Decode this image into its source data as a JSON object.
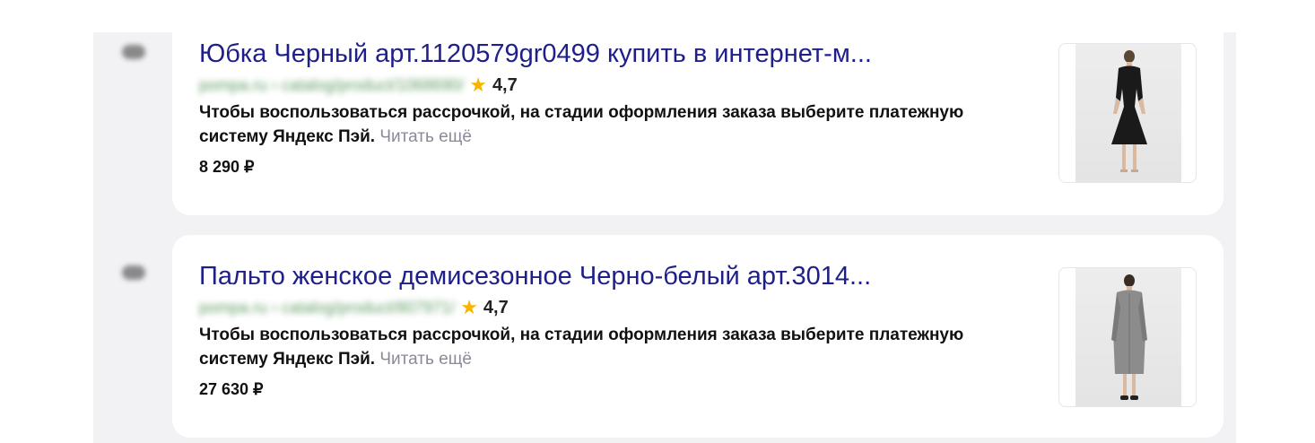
{
  "results": [
    {
      "title": "Юбка Черный арт.1120579gr0499 купить в интернет-м...",
      "url": "pompa.ru › catalog/product/1068690/",
      "rating": "4,7",
      "snippet": "Чтобы воспользоваться рассрочкой, на стадии оформления заказа выберите платежную систему Яндекс Пэй.",
      "read_more": "Читать ещё",
      "price": "8 290 ₽"
    },
    {
      "title": "Пальто женское демисезонное Черно-белый арт.3014...",
      "url": "pompa.ru › catalog/product/807971/",
      "rating": "4,7",
      "snippet": "Чтобы воспользоваться рассрочкой, на стадии оформления заказа выберите платежную систему Яндекс Пэй.",
      "read_more": "Читать ещё",
      "price": "27 630 ₽"
    }
  ],
  "icons": {
    "rating": "star-icon",
    "favicon": "site-favicon-icon"
  },
  "colors": {
    "title_link": "#1f1f8a",
    "url_green": "#2e7d32",
    "star": "#f7b500",
    "read_more": "#8a8a99",
    "page_bg": "#f2f2f5"
  }
}
